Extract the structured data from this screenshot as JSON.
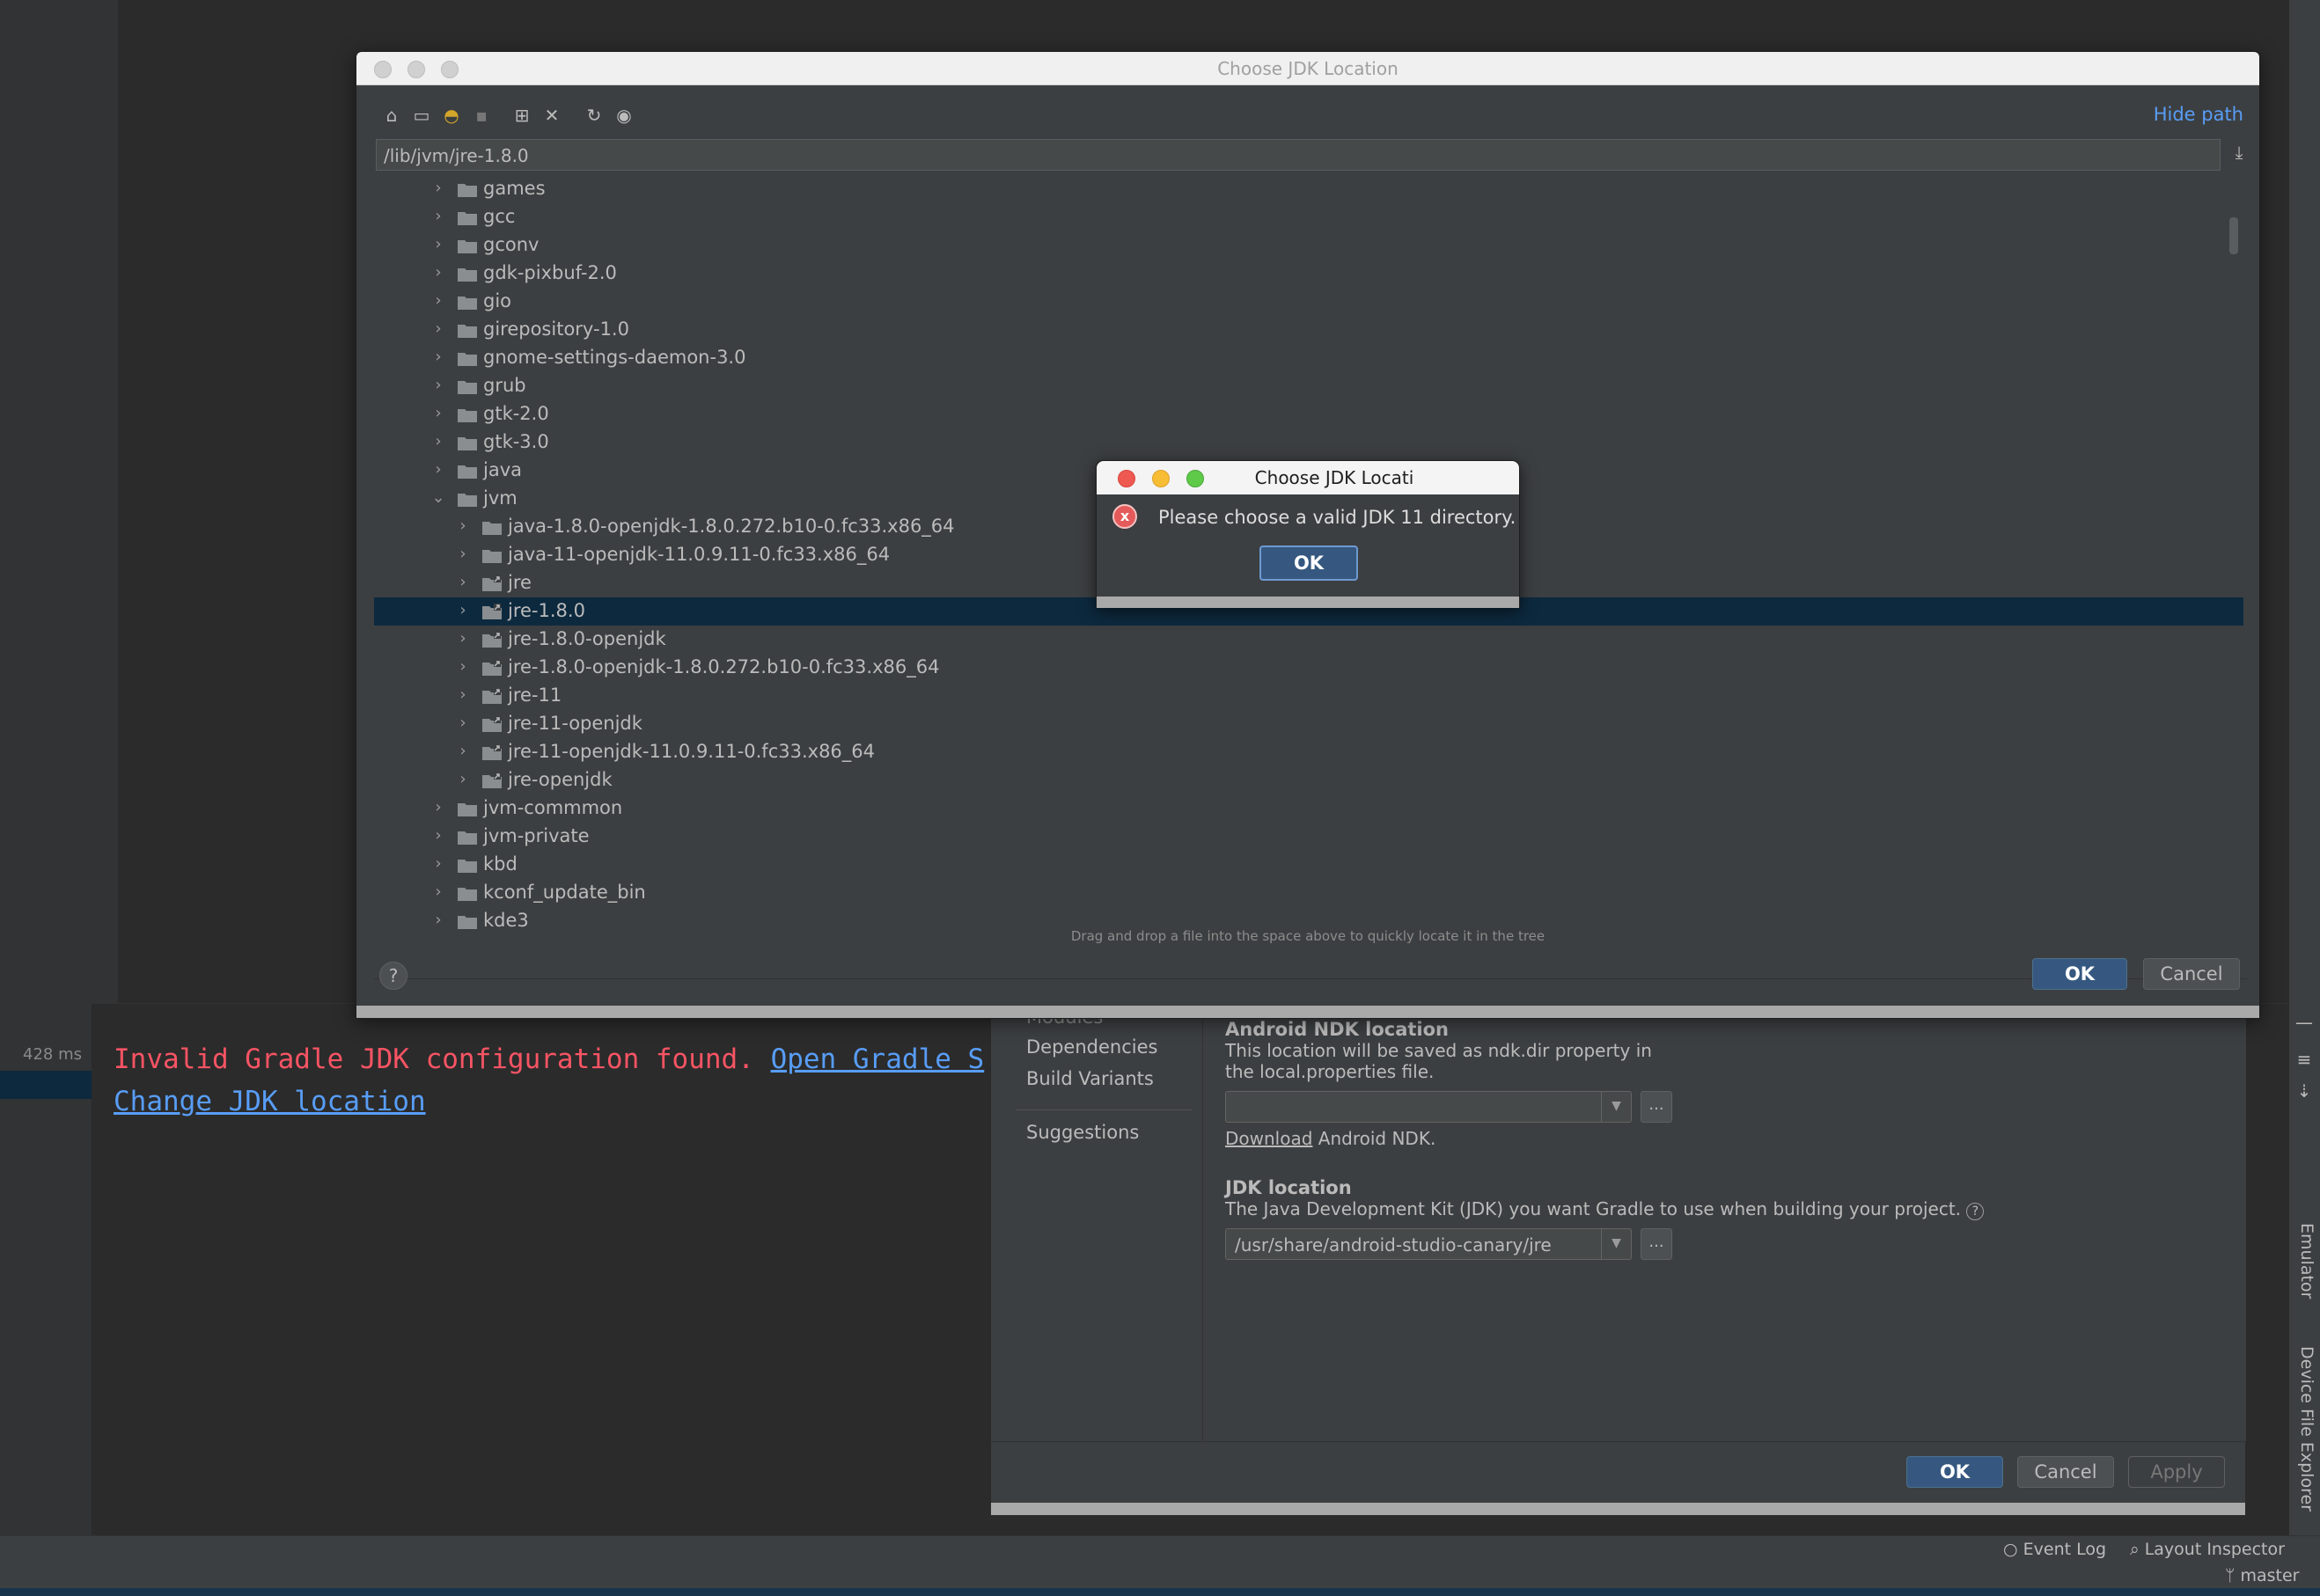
{
  "ide": {
    "run": {
      "time": "428 ms",
      "error_text": "Invalid Gradle JDK configuration found.",
      "open_link": "Open Gradle S",
      "change_link": "Change JDK location"
    },
    "right_tools": {
      "emulator": "Emulator",
      "device_explorer": "Device File Explorer"
    },
    "status": {
      "event_log": "Event Log",
      "layout_inspector": "Layout Inspector",
      "branch": "master"
    }
  },
  "project_structure": {
    "nav": {
      "modules": "Modules",
      "dependencies": "Dependencies",
      "build_variants": "Build Variants",
      "suggestions": "Suggestions"
    },
    "ndk": {
      "heading": "Android NDK location",
      "desc1": "This location will be saved as ndk.dir property in",
      "desc2": "the local.properties file.",
      "value": "",
      "download_link": "Download",
      "download_rest": " Android NDK."
    },
    "jdk": {
      "heading": "JDK location",
      "desc": "The Java Development Kit (JDK) you want Gradle to use when building your project.",
      "value": "/usr/share/android-studio-canary/jre"
    },
    "buttons": {
      "ok": "OK",
      "cancel": "Cancel",
      "apply": "Apply"
    }
  },
  "file_chooser": {
    "title": "Choose JDK Location",
    "hide_path": "Hide path",
    "path": "/lib/jvm/jre-1.8.0",
    "hint": "Drag and drop a file into the space above to quickly locate it in the tree",
    "buttons": {
      "ok": "OK",
      "cancel": "Cancel",
      "help": "?"
    },
    "toolbar_icons": [
      "home-icon",
      "desktop-icon",
      "android-icon",
      "module-icon",
      "new-folder-icon",
      "delete-icon",
      "refresh-icon",
      "show-hidden-icon"
    ],
    "tree": [
      {
        "label": "games",
        "depth": 0,
        "expanded": false,
        "selected": false,
        "link": false
      },
      {
        "label": "gcc",
        "depth": 0,
        "expanded": false,
        "selected": false,
        "link": false
      },
      {
        "label": "gconv",
        "depth": 0,
        "expanded": false,
        "selected": false,
        "link": false
      },
      {
        "label": "gdk-pixbuf-2.0",
        "depth": 0,
        "expanded": false,
        "selected": false,
        "link": false
      },
      {
        "label": "gio",
        "depth": 0,
        "expanded": false,
        "selected": false,
        "link": false
      },
      {
        "label": "girepository-1.0",
        "depth": 0,
        "expanded": false,
        "selected": false,
        "link": false
      },
      {
        "label": "gnome-settings-daemon-3.0",
        "depth": 0,
        "expanded": false,
        "selected": false,
        "link": false
      },
      {
        "label": "grub",
        "depth": 0,
        "expanded": false,
        "selected": false,
        "link": false
      },
      {
        "label": "gtk-2.0",
        "depth": 0,
        "expanded": false,
        "selected": false,
        "link": false
      },
      {
        "label": "gtk-3.0",
        "depth": 0,
        "expanded": false,
        "selected": false,
        "link": false
      },
      {
        "label": "java",
        "depth": 0,
        "expanded": false,
        "selected": false,
        "link": false
      },
      {
        "label": "jvm",
        "depth": 0,
        "expanded": true,
        "selected": false,
        "link": false
      },
      {
        "label": "java-1.8.0-openjdk-1.8.0.272.b10-0.fc33.x86_64",
        "depth": 1,
        "expanded": false,
        "selected": false,
        "link": false
      },
      {
        "label": "java-11-openjdk-11.0.9.11-0.fc33.x86_64",
        "depth": 1,
        "expanded": false,
        "selected": false,
        "link": false
      },
      {
        "label": "jre",
        "depth": 1,
        "expanded": false,
        "selected": false,
        "link": true
      },
      {
        "label": "jre-1.8.0",
        "depth": 1,
        "expanded": false,
        "selected": true,
        "link": true
      },
      {
        "label": "jre-1.8.0-openjdk",
        "depth": 1,
        "expanded": false,
        "selected": false,
        "link": true
      },
      {
        "label": "jre-1.8.0-openjdk-1.8.0.272.b10-0.fc33.x86_64",
        "depth": 1,
        "expanded": false,
        "selected": false,
        "link": true
      },
      {
        "label": "jre-11",
        "depth": 1,
        "expanded": false,
        "selected": false,
        "link": true
      },
      {
        "label": "jre-11-openjdk",
        "depth": 1,
        "expanded": false,
        "selected": false,
        "link": true
      },
      {
        "label": "jre-11-openjdk-11.0.9.11-0.fc33.x86_64",
        "depth": 1,
        "expanded": false,
        "selected": false,
        "link": true
      },
      {
        "label": "jre-openjdk",
        "depth": 1,
        "expanded": false,
        "selected": false,
        "link": true
      },
      {
        "label": "jvm-commmon",
        "depth": 0,
        "expanded": false,
        "selected": false,
        "link": false
      },
      {
        "label": "jvm-private",
        "depth": 0,
        "expanded": false,
        "selected": false,
        "link": false
      },
      {
        "label": "kbd",
        "depth": 0,
        "expanded": false,
        "selected": false,
        "link": false
      },
      {
        "label": "kconf_update_bin",
        "depth": 0,
        "expanded": false,
        "selected": false,
        "link": false
      },
      {
        "label": "kde3",
        "depth": 0,
        "expanded": false,
        "selected": false,
        "link": false
      }
    ]
  },
  "error_popup": {
    "title": "Choose JDK Locati",
    "message": "Please choose a valid JDK 11 directory.",
    "ok": "OK"
  },
  "colors": {
    "accent_link": "#589df6",
    "error_text": "#f75464",
    "selection": "#0d293e",
    "primary_button": "#365880"
  }
}
